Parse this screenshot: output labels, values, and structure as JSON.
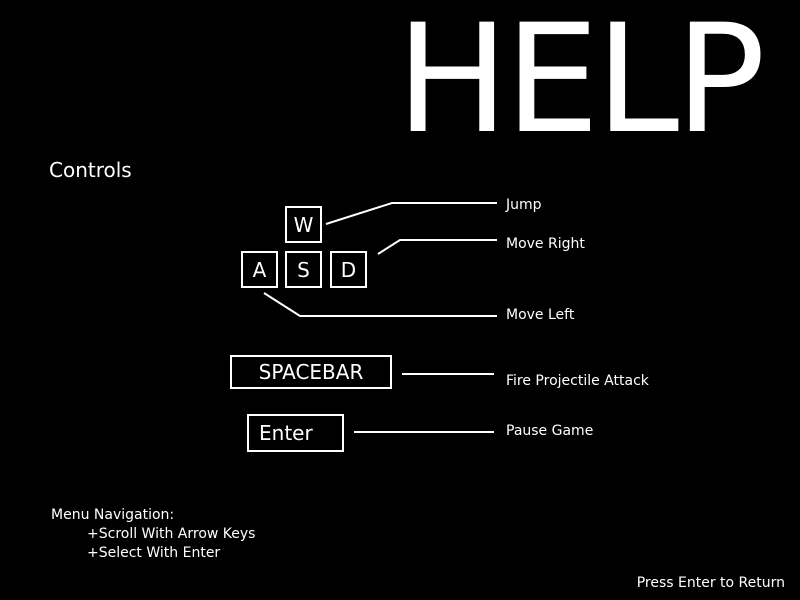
{
  "title": "HELP",
  "controls_heading": "Controls",
  "keys": {
    "w": "W",
    "a": "A",
    "s": "S",
    "d": "D",
    "spacebar": "SPACEBAR",
    "enter": "Enter"
  },
  "actions": {
    "jump": "Jump",
    "move_right": "Move Right",
    "move_left": "Move Left",
    "fire": "Fire Projectile Attack",
    "pause": "Pause Game"
  },
  "menu_navigation": {
    "heading": "Menu Navigation:",
    "scroll": "+Scroll With Arrow Keys",
    "select": "+Select With Enter"
  },
  "return_hint": "Press Enter to Return",
  "colors": {
    "background": "#000000",
    "foreground": "#ffffff"
  }
}
